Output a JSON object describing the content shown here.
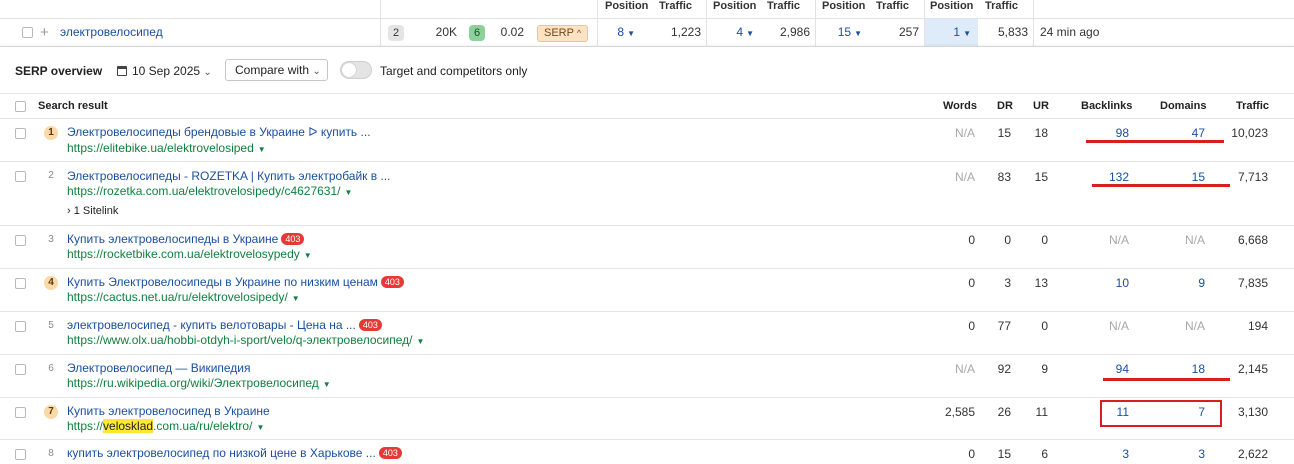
{
  "top_headers": [
    "Position",
    "Traffic",
    "Position",
    "Traffic",
    "Position",
    "Traffic",
    "Position",
    "Traffic"
  ],
  "keyword_row": {
    "keyword": "электровелосипед",
    "kd_a": "2",
    "volume": "20K",
    "kd_b": "6",
    "cpc": "0.02",
    "serp_label": "SERP",
    "p1": "8",
    "t1": "1,223",
    "p2": "4",
    "t2": "2,986",
    "p3": "15",
    "t3": "257",
    "p4": "1",
    "t4": "5,833",
    "updated": "24 min ago"
  },
  "overview": {
    "title": "SERP overview",
    "date": "10 Sep 2025",
    "compare_label": "Compare with",
    "toggle_label": "Target and competitors only"
  },
  "table_headers": {
    "result": "Search result",
    "words": "Words",
    "dr": "DR",
    "ur": "UR",
    "backlinks": "Backlinks",
    "domains": "Domains",
    "traffic": "Traffic"
  },
  "results": [
    {
      "pos": "1",
      "title": "Электровелосипеды брендовые в Украине ᐅ купить ...",
      "url": "https://elitebike.ua/elektrovelosiped",
      "words": "N/A",
      "dr": "15",
      "ur": "18",
      "backlinks": "98",
      "domains": "47",
      "traffic": "10,023"
    },
    {
      "pos": "2",
      "title": "Электровелосипеды - ROZETKA | Купить электробайк в ...",
      "url": "https://rozetka.com.ua/elektrovelosipedy/c4627631/",
      "sitelink": "1 Sitelink",
      "words": "N/A",
      "dr": "83",
      "ur": "15",
      "backlinks": "132",
      "domains": "15",
      "traffic": "7,713"
    },
    {
      "pos": "3",
      "title": "Купить электровелосипеды в Украине",
      "badge": "403",
      "url": "https://rocketbike.com.ua/elektrovelosypedy",
      "words": "0",
      "dr": "0",
      "ur": "0",
      "backlinks": "N/A",
      "domains": "N/A",
      "traffic": "6,668"
    },
    {
      "pos": "4",
      "title": "Купить Электровелосипеды в Украине по низким ценам",
      "badge": "403",
      "url": "https://cactus.net.ua/ru/elektrovelosipedy/",
      "words": "0",
      "dr": "3",
      "ur": "13",
      "backlinks": "10",
      "domains": "9",
      "traffic": "7,835"
    },
    {
      "pos": "5",
      "title": "электровелосипед - купить велотовары - Цена на ...",
      "badge": "403",
      "url": "https://www.olx.ua/hobbi-otdyh-i-sport/velo/q-электровелосипед/",
      "words": "0",
      "dr": "77",
      "ur": "0",
      "backlinks": "N/A",
      "domains": "N/A",
      "traffic": "194"
    },
    {
      "pos": "6",
      "title": "Электровелосипед — Википедия",
      "url": "https://ru.wikipedia.org/wiki/Электровелосипед",
      "words": "N/A",
      "dr": "92",
      "ur": "9",
      "backlinks": "94",
      "domains": "18",
      "traffic": "2,145"
    },
    {
      "pos": "7",
      "title": "Купить электровелосипед в Украине",
      "url_pre": "https://",
      "url_hl": "velosklad",
      "url_post": ".com.ua/ru/elektro/",
      "words": "2,585",
      "dr": "26",
      "ur": "11",
      "backlinks": "11",
      "domains": "7",
      "traffic": "3,130"
    },
    {
      "pos": "8",
      "title": "купить электровелосипед по низкой цене в Харькове ...",
      "badge": "403",
      "words": "0",
      "dr": "15",
      "ur": "6",
      "backlinks": "3",
      "domains": "3",
      "traffic": "2,622"
    }
  ],
  "colors": {
    "link_blue": "#1a4fa0",
    "url_green": "#11803f",
    "annotation_red": "#d71f1f",
    "badge_red": "#e53935",
    "serp_orange": "#fde3c3",
    "highlight_yellow": "#ffe930"
  }
}
